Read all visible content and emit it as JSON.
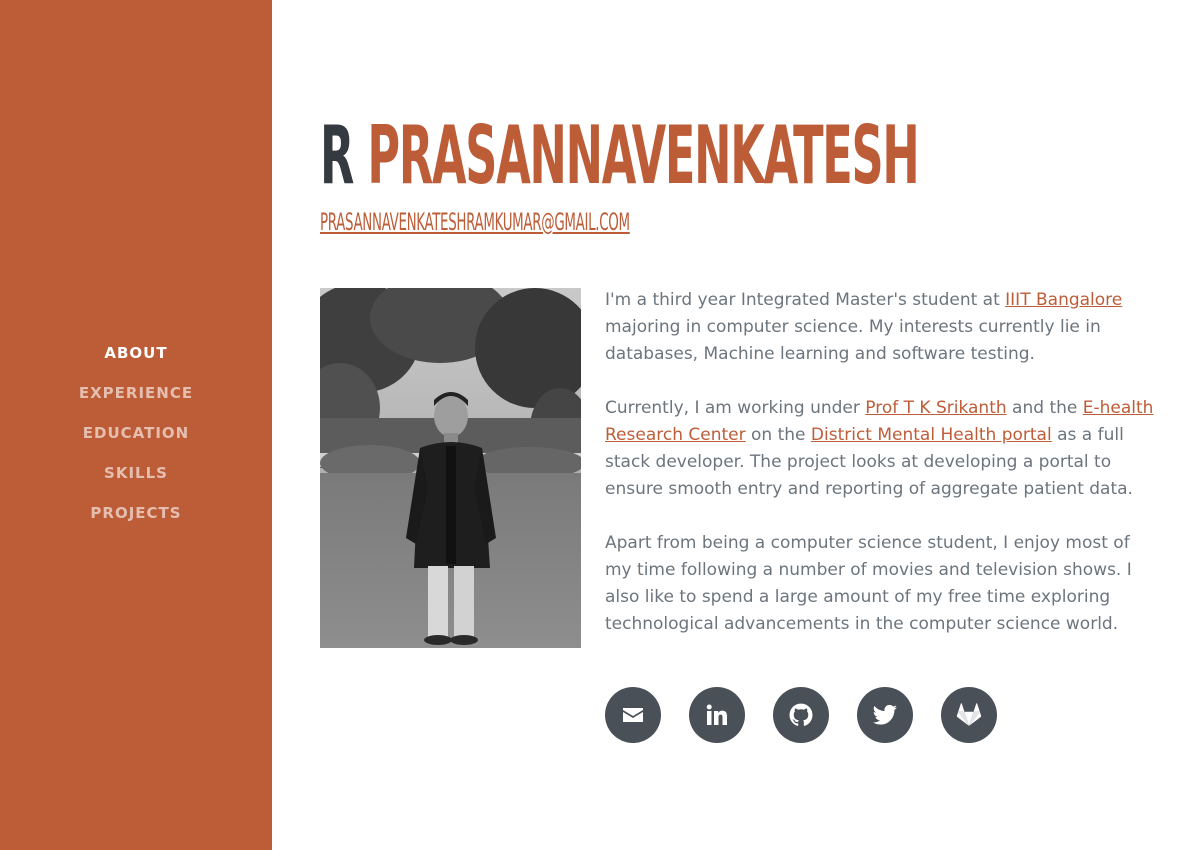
{
  "nav": {
    "items": [
      {
        "label": "About",
        "active": true
      },
      {
        "label": "Experience",
        "active": false
      },
      {
        "label": "Education",
        "active": false
      },
      {
        "label": "Skills",
        "active": false
      },
      {
        "label": "Projects",
        "active": false
      }
    ]
  },
  "header": {
    "first_name": "R",
    "last_name": "Prasannavenkatesh",
    "email": "prasannavenkateshramkumar@gmail.com"
  },
  "bio": {
    "p1_before": "I'm a third year Integrated Master's student at ",
    "p1_link": "IIIT Bangalore",
    "p1_after": " majoring in computer science. My interests currently lie in databases, Machine learning and software testing.",
    "p2_before": "Currently, I am working under ",
    "p2_link1": "Prof T K Srikanth",
    "p2_mid1": " and the ",
    "p2_link2": "E-health Research Center",
    "p2_mid2": " on the ",
    "p2_link3": "District Mental Health portal",
    "p2_after": " as a full stack developer. The project looks at developing a portal to ensure smooth entry and reporting of aggregate patient data.",
    "p3": "Apart from being a computer science student, I enjoy most of my time following a number of movies and television shows. I also like to spend a large amount of my free time exploring technological advancements in the computer science world."
  },
  "social": {
    "icons": [
      "envelope-icon",
      "linkedin-icon",
      "github-icon",
      "twitter-icon",
      "gitlab-icon"
    ]
  },
  "colors": {
    "accent": "#bd5d38",
    "dark": "#343a40",
    "text": "#6c757d",
    "social_bg": "#495057"
  }
}
